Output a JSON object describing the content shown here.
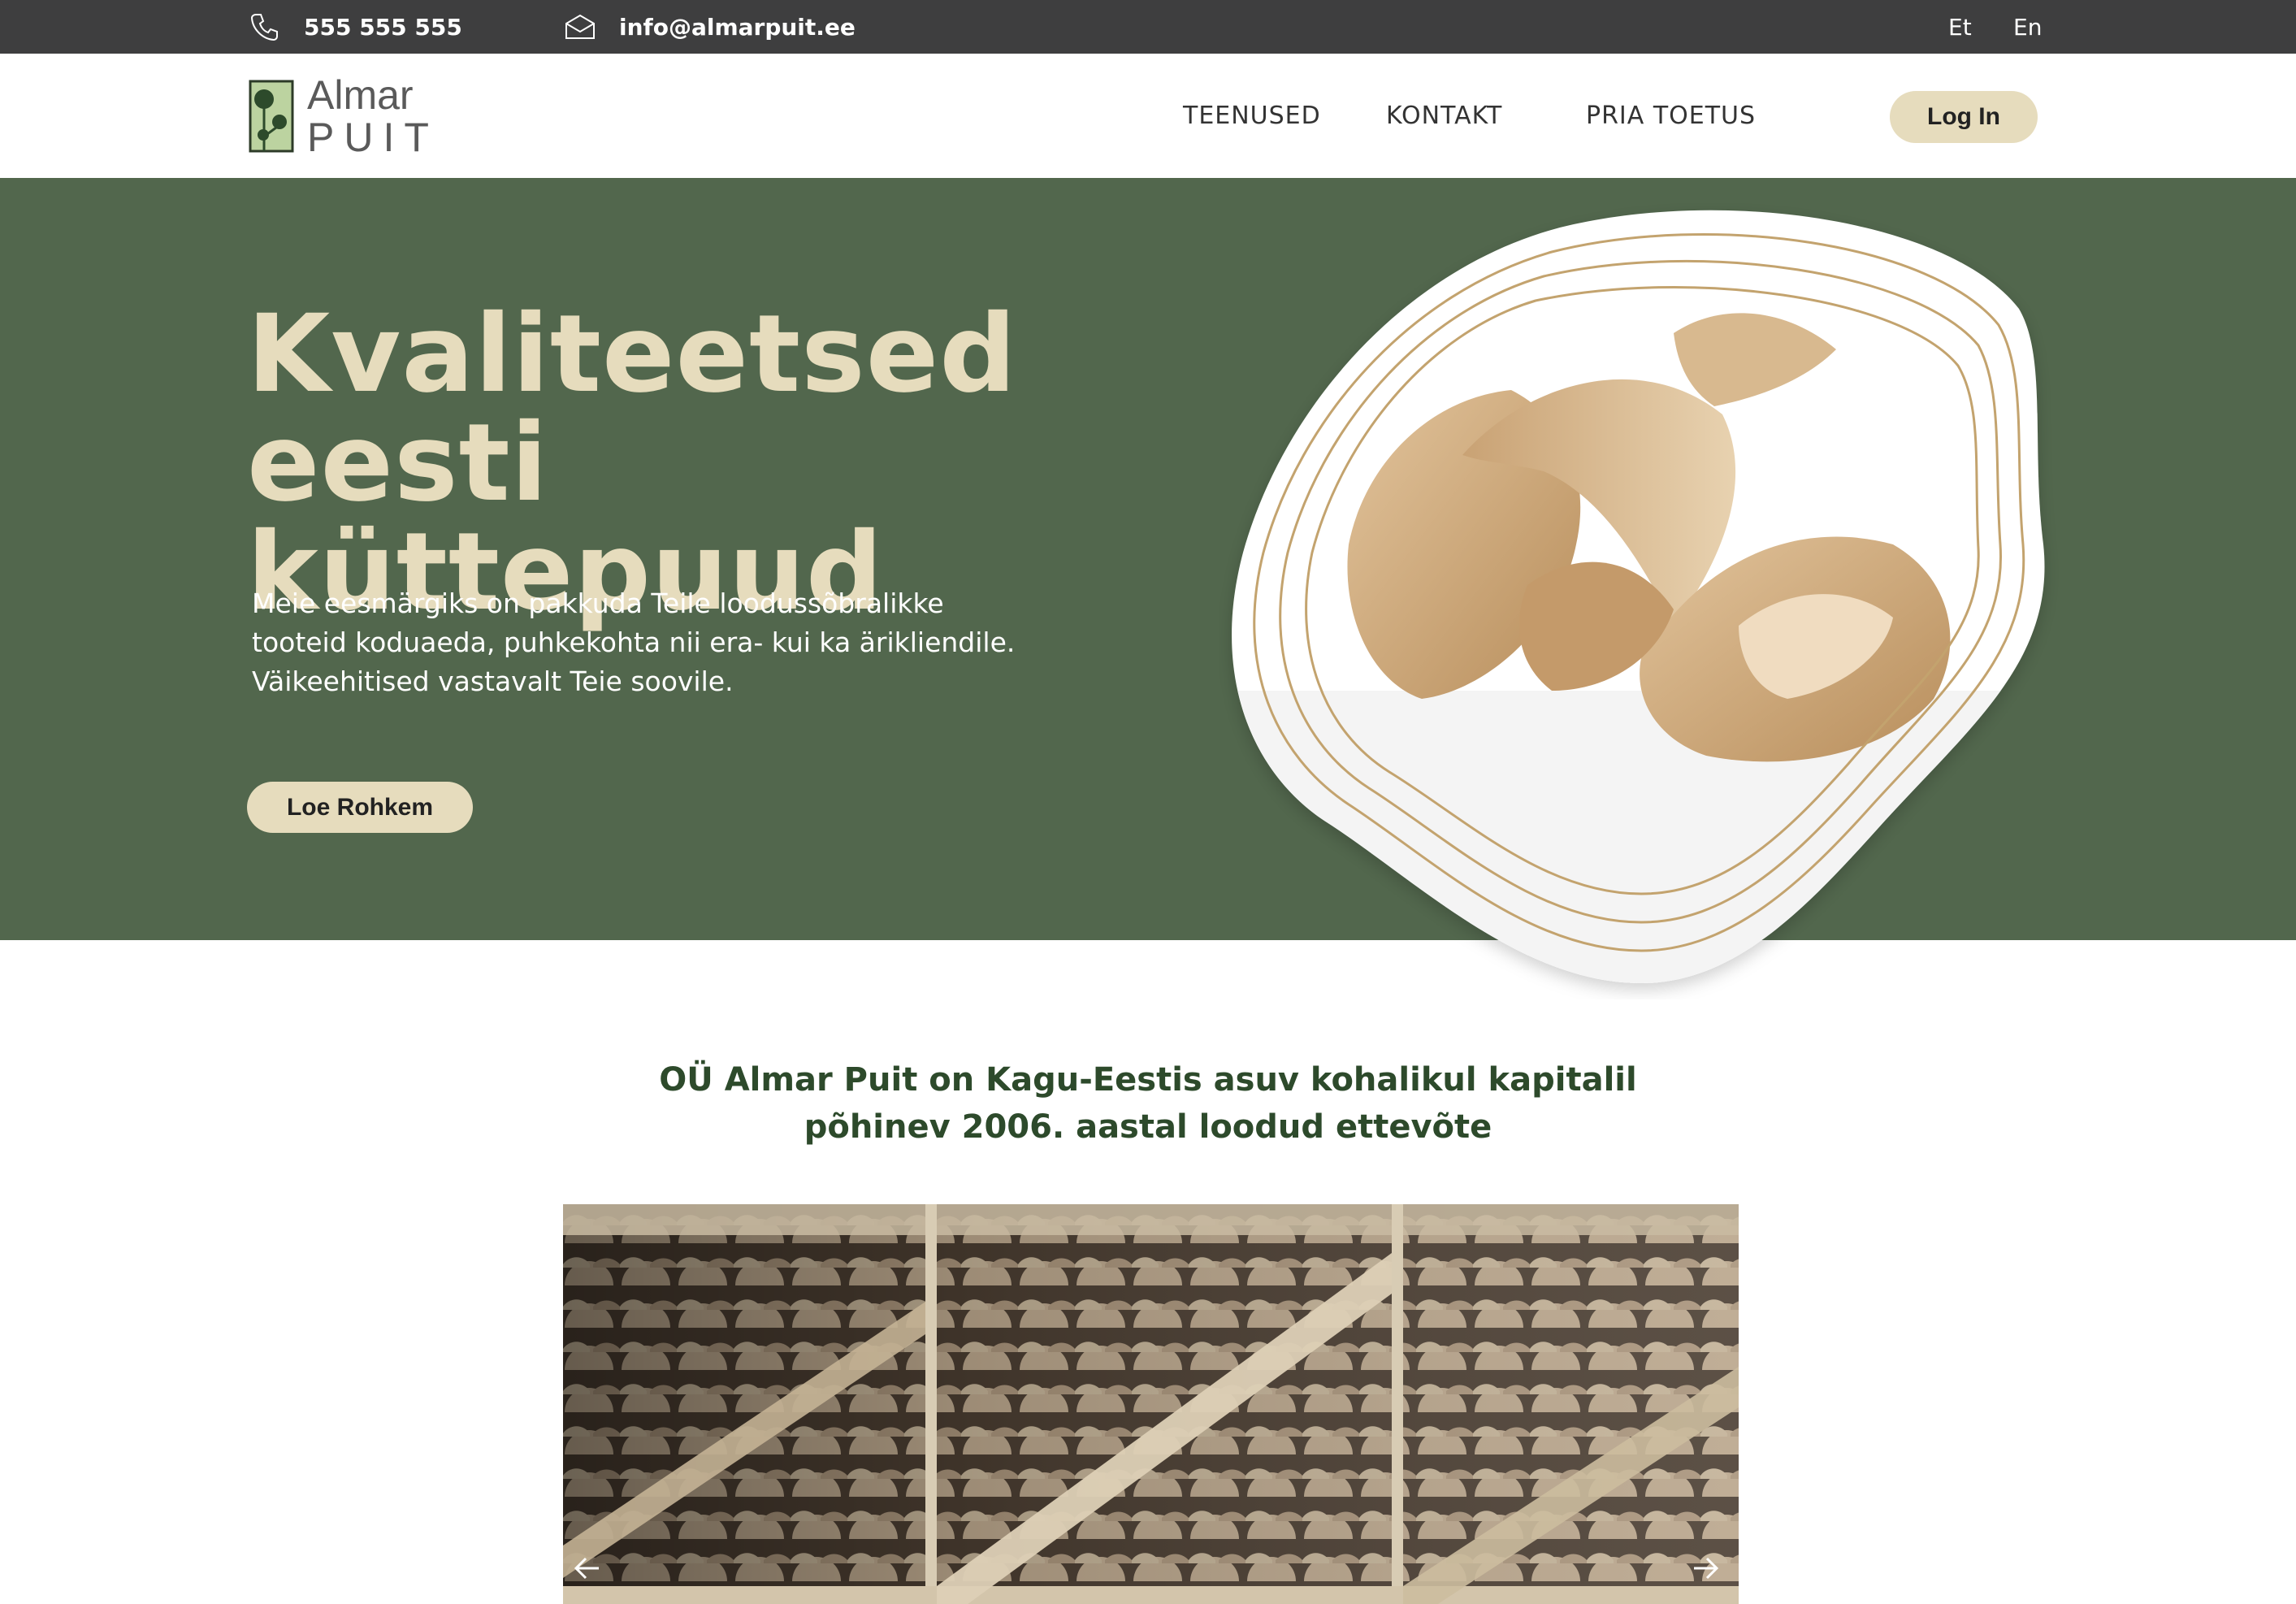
{
  "topbar": {
    "phone": "555 555 555",
    "email": "info@almarpuit.ee",
    "languages": [
      "Et",
      "En"
    ],
    "background": "#3e3e3f"
  },
  "header": {
    "logo": {
      "line1": "Almar",
      "line2": "PUIT"
    },
    "nav": [
      "TEENUSED",
      "KONTAKT",
      "PRIA TOETUS"
    ],
    "login_label": "Log In"
  },
  "hero": {
    "title_line1": "Kvaliteetsed eesti",
    "title_line2": "küttepuud",
    "text_line1": "Meie eesmärgiks on pakkuda Teile loodussõbralikke",
    "text_line2": "tooteid koduaeda, puhkekohta nii era- kui ka ärikliendile.",
    "text_line3": "Väikeehitised vastavalt Teie soovile.",
    "button_label": "Loe Rohkem",
    "background": "#52674d",
    "accent": "#e6dcbd"
  },
  "intro": {
    "line1": "OÜ Almar Puit on Kagu-Eestis asuv kohalikul kapitalil",
    "line2": "põhinev 2006. aastal loodud ettevõte"
  },
  "gallery": {
    "prev_icon": "arrow-left-icon",
    "next_icon": "arrow-right-icon"
  }
}
